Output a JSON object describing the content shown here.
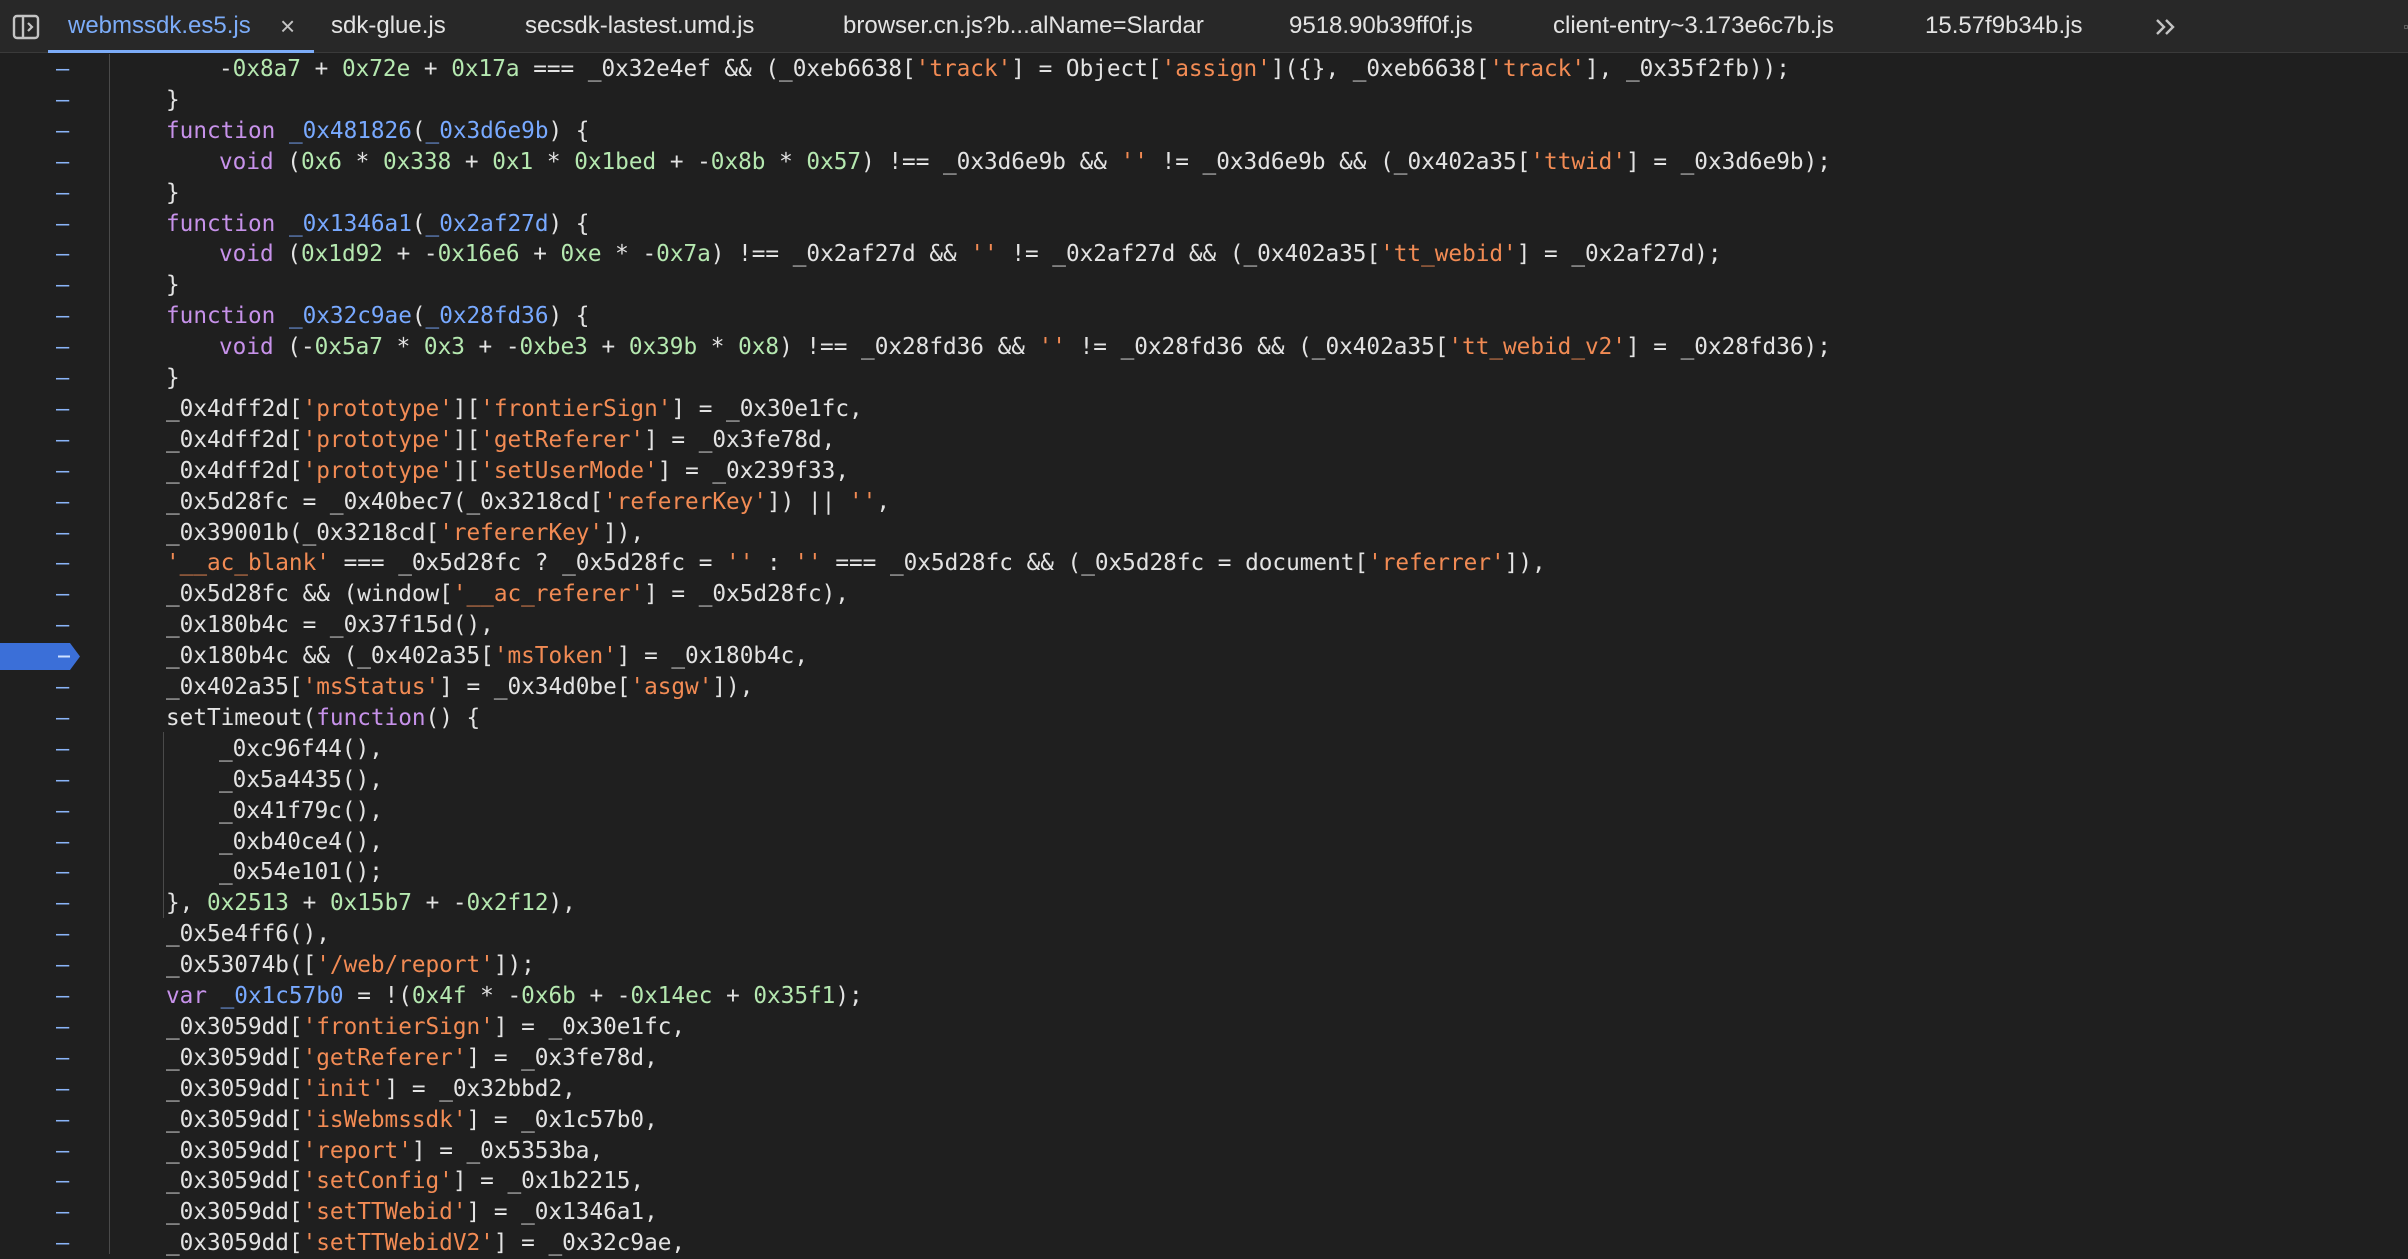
{
  "toolbar": {
    "sidebar_toggle_icon": "sidebar-toggle-icon",
    "more_tabs_icon": "chevrons-right-icon",
    "close_label": "×"
  },
  "tabs": [
    {
      "label": "webmssdk.es5.js",
      "active": true
    },
    {
      "label": "sdk-glue.js"
    },
    {
      "label": "secsdk-lastest.umd.js"
    },
    {
      "label": "browser.cn.js?b...alName=Slardar"
    },
    {
      "label": "9518.90b39ff0f.js"
    },
    {
      "label": "client-entry~3.173e6c7b.js"
    },
    {
      "label": "15.57f9b34b.js"
    }
  ],
  "gutter_marker": "–",
  "paused_line_index": 19,
  "colors": {
    "background": "#1f1f1f",
    "keyword": "#c792ea",
    "function": "#78a9ff",
    "string": "#f28b54",
    "number": "#b5e8b0",
    "text": "#e3e3e3",
    "breakpoint": "#3b6fd8"
  },
  "lines": [
    {
      "indent": 3,
      "tokens": [
        [
          "t",
          "-"
        ],
        [
          "n",
          "0x8a7"
        ],
        [
          "t",
          " + "
        ],
        [
          "n",
          "0x72e"
        ],
        [
          "t",
          " + "
        ],
        [
          "n",
          "0x17a"
        ],
        [
          "t",
          " === _0x32e4ef && (_0xeb6638["
        ],
        [
          "s",
          "'track'"
        ],
        [
          "t",
          "] = Object["
        ],
        [
          "s",
          "'assign'"
        ],
        [
          "t",
          "]({}, _0xeb6638["
        ],
        [
          "s",
          "'track'"
        ],
        [
          "t",
          "], _0x35f2fb));"
        ]
      ]
    },
    {
      "indent": 2,
      "tokens": [
        [
          "t",
          "}"
        ]
      ]
    },
    {
      "indent": 2,
      "tokens": [
        [
          "k",
          "function "
        ],
        [
          "f",
          "_0x481826"
        ],
        [
          "t",
          "("
        ],
        [
          "f",
          "_0x3d6e9b"
        ],
        [
          "t",
          ") {"
        ]
      ]
    },
    {
      "indent": 3,
      "tokens": [
        [
          "k",
          "void"
        ],
        [
          "t",
          " ("
        ],
        [
          "n",
          "0x6"
        ],
        [
          "t",
          " * "
        ],
        [
          "n",
          "0x338"
        ],
        [
          "t",
          " + "
        ],
        [
          "n",
          "0x1"
        ],
        [
          "t",
          " * "
        ],
        [
          "n",
          "0x1bed"
        ],
        [
          "t",
          " + -"
        ],
        [
          "n",
          "0x8b"
        ],
        [
          "t",
          " * "
        ],
        [
          "n",
          "0x57"
        ],
        [
          "t",
          ") !== _0x3d6e9b && "
        ],
        [
          "s",
          "''"
        ],
        [
          "t",
          " != _0x3d6e9b && (_0x402a35["
        ],
        [
          "s",
          "'ttwid'"
        ],
        [
          "t",
          "] = _0x3d6e9b);"
        ]
      ]
    },
    {
      "indent": 2,
      "tokens": [
        [
          "t",
          "}"
        ]
      ]
    },
    {
      "indent": 2,
      "tokens": [
        [
          "k",
          "function "
        ],
        [
          "f",
          "_0x1346a1"
        ],
        [
          "t",
          "("
        ],
        [
          "f",
          "_0x2af27d"
        ],
        [
          "t",
          ") {"
        ]
      ]
    },
    {
      "indent": 3,
      "tokens": [
        [
          "k",
          "void"
        ],
        [
          "t",
          " ("
        ],
        [
          "n",
          "0x1d92"
        ],
        [
          "t",
          " + -"
        ],
        [
          "n",
          "0x16e6"
        ],
        [
          "t",
          " + "
        ],
        [
          "n",
          "0xe"
        ],
        [
          "t",
          " * -"
        ],
        [
          "n",
          "0x7a"
        ],
        [
          "t",
          ") !== _0x2af27d && "
        ],
        [
          "s",
          "''"
        ],
        [
          "t",
          " != _0x2af27d && (_0x402a35["
        ],
        [
          "s",
          "'tt_webid'"
        ],
        [
          "t",
          "] = _0x2af27d);"
        ]
      ]
    },
    {
      "indent": 2,
      "tokens": [
        [
          "t",
          "}"
        ]
      ]
    },
    {
      "indent": 2,
      "tokens": [
        [
          "k",
          "function "
        ],
        [
          "f",
          "_0x32c9ae"
        ],
        [
          "t",
          "("
        ],
        [
          "f",
          "_0x28fd36"
        ],
        [
          "t",
          ") {"
        ]
      ]
    },
    {
      "indent": 3,
      "tokens": [
        [
          "k",
          "void"
        ],
        [
          "t",
          " (-"
        ],
        [
          "n",
          "0x5a7"
        ],
        [
          "t",
          " * "
        ],
        [
          "n",
          "0x3"
        ],
        [
          "t",
          " + -"
        ],
        [
          "n",
          "0xbe3"
        ],
        [
          "t",
          " + "
        ],
        [
          "n",
          "0x39b"
        ],
        [
          "t",
          " * "
        ],
        [
          "n",
          "0x8"
        ],
        [
          "t",
          ") !== _0x28fd36 && "
        ],
        [
          "s",
          "''"
        ],
        [
          "t",
          " != _0x28fd36 && (_0x402a35["
        ],
        [
          "s",
          "'tt_webid_v2'"
        ],
        [
          "t",
          "] = _0x28fd36);"
        ]
      ]
    },
    {
      "indent": 2,
      "tokens": [
        [
          "t",
          "}"
        ]
      ]
    },
    {
      "indent": 2,
      "tokens": [
        [
          "t",
          "_0x4dff2d["
        ],
        [
          "s",
          "'prototype'"
        ],
        [
          "t",
          "]["
        ],
        [
          "s",
          "'frontierSign'"
        ],
        [
          "t",
          "] = _0x30e1fc,"
        ]
      ]
    },
    {
      "indent": 2,
      "tokens": [
        [
          "t",
          "_0x4dff2d["
        ],
        [
          "s",
          "'prototype'"
        ],
        [
          "t",
          "]["
        ],
        [
          "s",
          "'getReferer'"
        ],
        [
          "t",
          "] = _0x3fe78d,"
        ]
      ]
    },
    {
      "indent": 2,
      "tokens": [
        [
          "t",
          "_0x4dff2d["
        ],
        [
          "s",
          "'prototype'"
        ],
        [
          "t",
          "]["
        ],
        [
          "s",
          "'setUserMode'"
        ],
        [
          "t",
          "] = _0x239f33,"
        ]
      ]
    },
    {
      "indent": 2,
      "tokens": [
        [
          "t",
          "_0x5d28fc = _0x40bec7(_0x3218cd["
        ],
        [
          "s",
          "'refererKey'"
        ],
        [
          "t",
          "]) || "
        ],
        [
          "s",
          "''"
        ],
        [
          "t",
          ","
        ]
      ]
    },
    {
      "indent": 2,
      "tokens": [
        [
          "t",
          "_0x39001b(_0x3218cd["
        ],
        [
          "s",
          "'refererKey'"
        ],
        [
          "t",
          "]),"
        ]
      ]
    },
    {
      "indent": 2,
      "tokens": [
        [
          "s",
          "'__ac_blank'"
        ],
        [
          "t",
          " === _0x5d28fc ? _0x5d28fc = "
        ],
        [
          "s",
          "''"
        ],
        [
          "t",
          " : "
        ],
        [
          "s",
          "''"
        ],
        [
          "t",
          " === _0x5d28fc && (_0x5d28fc = document["
        ],
        [
          "s",
          "'referrer'"
        ],
        [
          "t",
          "]),"
        ]
      ]
    },
    {
      "indent": 2,
      "tokens": [
        [
          "t",
          "_0x5d28fc && (window["
        ],
        [
          "s",
          "'__ac_referer'"
        ],
        [
          "t",
          "] = _0x5d28fc),"
        ]
      ]
    },
    {
      "indent": 2,
      "tokens": [
        [
          "t",
          "_0x180b4c = _0x37f15d(),"
        ]
      ]
    },
    {
      "indent": 2,
      "tokens": [
        [
          "t",
          "_0x180b4c && (_0x402a35["
        ],
        [
          "s",
          "'msToken'"
        ],
        [
          "t",
          "] = _0x180b4c,"
        ]
      ]
    },
    {
      "indent": 2,
      "tokens": [
        [
          "t",
          "_0x402a35["
        ],
        [
          "s",
          "'msStatus'"
        ],
        [
          "t",
          "] = _0x34d0be["
        ],
        [
          "s",
          "'asgw'"
        ],
        [
          "t",
          "]),"
        ]
      ]
    },
    {
      "indent": 2,
      "tokens": [
        [
          "t",
          "setTimeout("
        ],
        [
          "k",
          "function"
        ],
        [
          "t",
          "() {"
        ]
      ]
    },
    {
      "indent": 3,
      "tokens": [
        [
          "t",
          "_0xc96f44(),"
        ]
      ]
    },
    {
      "indent": 3,
      "tokens": [
        [
          "t",
          "_0x5a4435(),"
        ]
      ]
    },
    {
      "indent": 3,
      "tokens": [
        [
          "t",
          "_0x41f79c(),"
        ]
      ]
    },
    {
      "indent": 3,
      "tokens": [
        [
          "t",
          "_0xb40ce4(),"
        ]
      ]
    },
    {
      "indent": 3,
      "tokens": [
        [
          "t",
          "_0x54e101();"
        ]
      ]
    },
    {
      "indent": 2,
      "tokens": [
        [
          "t",
          "}, "
        ],
        [
          "n",
          "0x2513"
        ],
        [
          "t",
          " + "
        ],
        [
          "n",
          "0x15b7"
        ],
        [
          "t",
          " + -"
        ],
        [
          "n",
          "0x2f12"
        ],
        [
          "t",
          "),"
        ]
      ]
    },
    {
      "indent": 2,
      "tokens": [
        [
          "t",
          "_0x5e4ff6(),"
        ]
      ]
    },
    {
      "indent": 2,
      "tokens": [
        [
          "t",
          "_0x53074b(["
        ],
        [
          "s",
          "'/web/report'"
        ],
        [
          "t",
          "]);"
        ]
      ]
    },
    {
      "indent": 2,
      "tokens": [
        [
          "k",
          "var "
        ],
        [
          "f",
          "_0x1c57b0"
        ],
        [
          "t",
          " = !("
        ],
        [
          "n",
          "0x4f"
        ],
        [
          "t",
          " * -"
        ],
        [
          "n",
          "0x6b"
        ],
        [
          "t",
          " + -"
        ],
        [
          "n",
          "0x14ec"
        ],
        [
          "t",
          " + "
        ],
        [
          "n",
          "0x35f1"
        ],
        [
          "t",
          ");"
        ]
      ]
    },
    {
      "indent": 2,
      "tokens": [
        [
          "t",
          "_0x3059dd["
        ],
        [
          "s",
          "'frontierSign'"
        ],
        [
          "t",
          "] = _0x30e1fc,"
        ]
      ]
    },
    {
      "indent": 2,
      "tokens": [
        [
          "t",
          "_0x3059dd["
        ],
        [
          "s",
          "'getReferer'"
        ],
        [
          "t",
          "] = _0x3fe78d,"
        ]
      ]
    },
    {
      "indent": 2,
      "tokens": [
        [
          "t",
          "_0x3059dd["
        ],
        [
          "s",
          "'init'"
        ],
        [
          "t",
          "] = _0x32bbd2,"
        ]
      ]
    },
    {
      "indent": 2,
      "tokens": [
        [
          "t",
          "_0x3059dd["
        ],
        [
          "s",
          "'isWebmssdk'"
        ],
        [
          "t",
          "] = _0x1c57b0,"
        ]
      ]
    },
    {
      "indent": 2,
      "tokens": [
        [
          "t",
          "_0x3059dd["
        ],
        [
          "s",
          "'report'"
        ],
        [
          "t",
          "] = _0x5353ba,"
        ]
      ]
    },
    {
      "indent": 2,
      "tokens": [
        [
          "t",
          "_0x3059dd["
        ],
        [
          "s",
          "'setConfig'"
        ],
        [
          "t",
          "] = _0x1b2215,"
        ]
      ]
    },
    {
      "indent": 2,
      "tokens": [
        [
          "t",
          "_0x3059dd["
        ],
        [
          "s",
          "'setTTWebid'"
        ],
        [
          "t",
          "] = _0x1346a1,"
        ]
      ]
    },
    {
      "indent": 2,
      "tokens": [
        [
          "t",
          "_0x3059dd["
        ],
        [
          "s",
          "'setTTWebidV2'"
        ],
        [
          "t",
          "] = _0x32c9ae,"
        ]
      ]
    }
  ]
}
